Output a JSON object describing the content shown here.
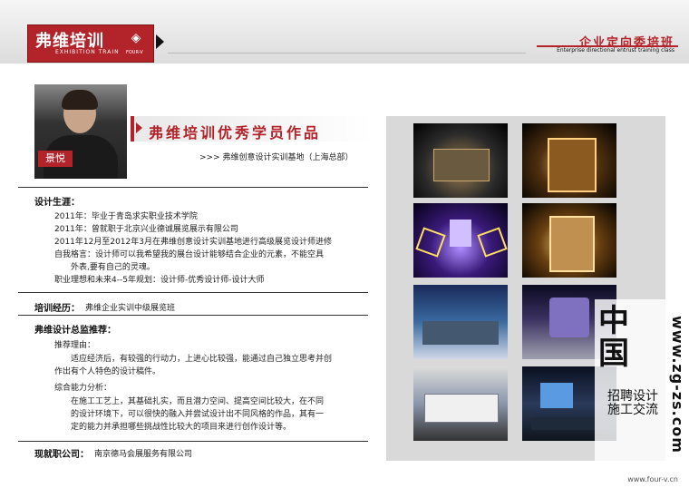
{
  "header": {
    "logo_text": "弗维培训",
    "logo_subtext": "EXHIBITION TRAIN",
    "logo_mark_label": "FOUR-V",
    "title": "企业定向委培班",
    "subtitle": "Enterprise directional entrust training class"
  },
  "student": {
    "name": "景悦"
  },
  "works": {
    "title": "弗维培训优秀学员作品",
    "subtitle": ">>> 弗维创意设计实训基地（上海总部）"
  },
  "career": {
    "label": "设计生涯：",
    "lines": [
      "2011年：毕业于青岛求实职业技术学院",
      "2011年：曾就职于北京兴业德诚展览展示有限公司",
      "2011年12月至2012年3月在弗维创意设计实训基地进行高级展览设计师进修",
      "自我格言：设计师可以我希望我的展台设计能够结合企业的元素，不能空具",
      "外表,要有自己的灵魂。",
      "职业理想和未来4--5年规划：设计师-优秀设计师-设计大师"
    ]
  },
  "training": {
    "label": "培训经历：",
    "value": "弗维企业实训中级展览班"
  },
  "recommend": {
    "label": "弗维设计总监推荐：",
    "reason_label": "推荐理由：",
    "reason_lines": [
      "适应经济后，有较强的行动力，上进心比较强，能通过自己独立思考并创",
      "作出有个人特色的设计稿件。"
    ],
    "ability_label": "综合能力分析：",
    "ability_lines": [
      "在施工工艺上，其基础扎实，而且潜力空间、提高空间比较大，在不同",
      "的设计环境下，可以很快的融入并尝试设计出不同风格的作品，其有一",
      "定的能力并承担哪些挑战性比较大的项目来进行创作设计等。"
    ]
  },
  "current_job": {
    "label": "现就职公司：",
    "value": "南京德马会展服务有限公司"
  },
  "watermark": {
    "chars": "中国",
    "side_text": "招聘设计施工交流",
    "url": "www.zg-zs.com"
  },
  "footer": {
    "url": "www.four-v.cn"
  },
  "colors": {
    "brand_red": "#b3232a"
  }
}
